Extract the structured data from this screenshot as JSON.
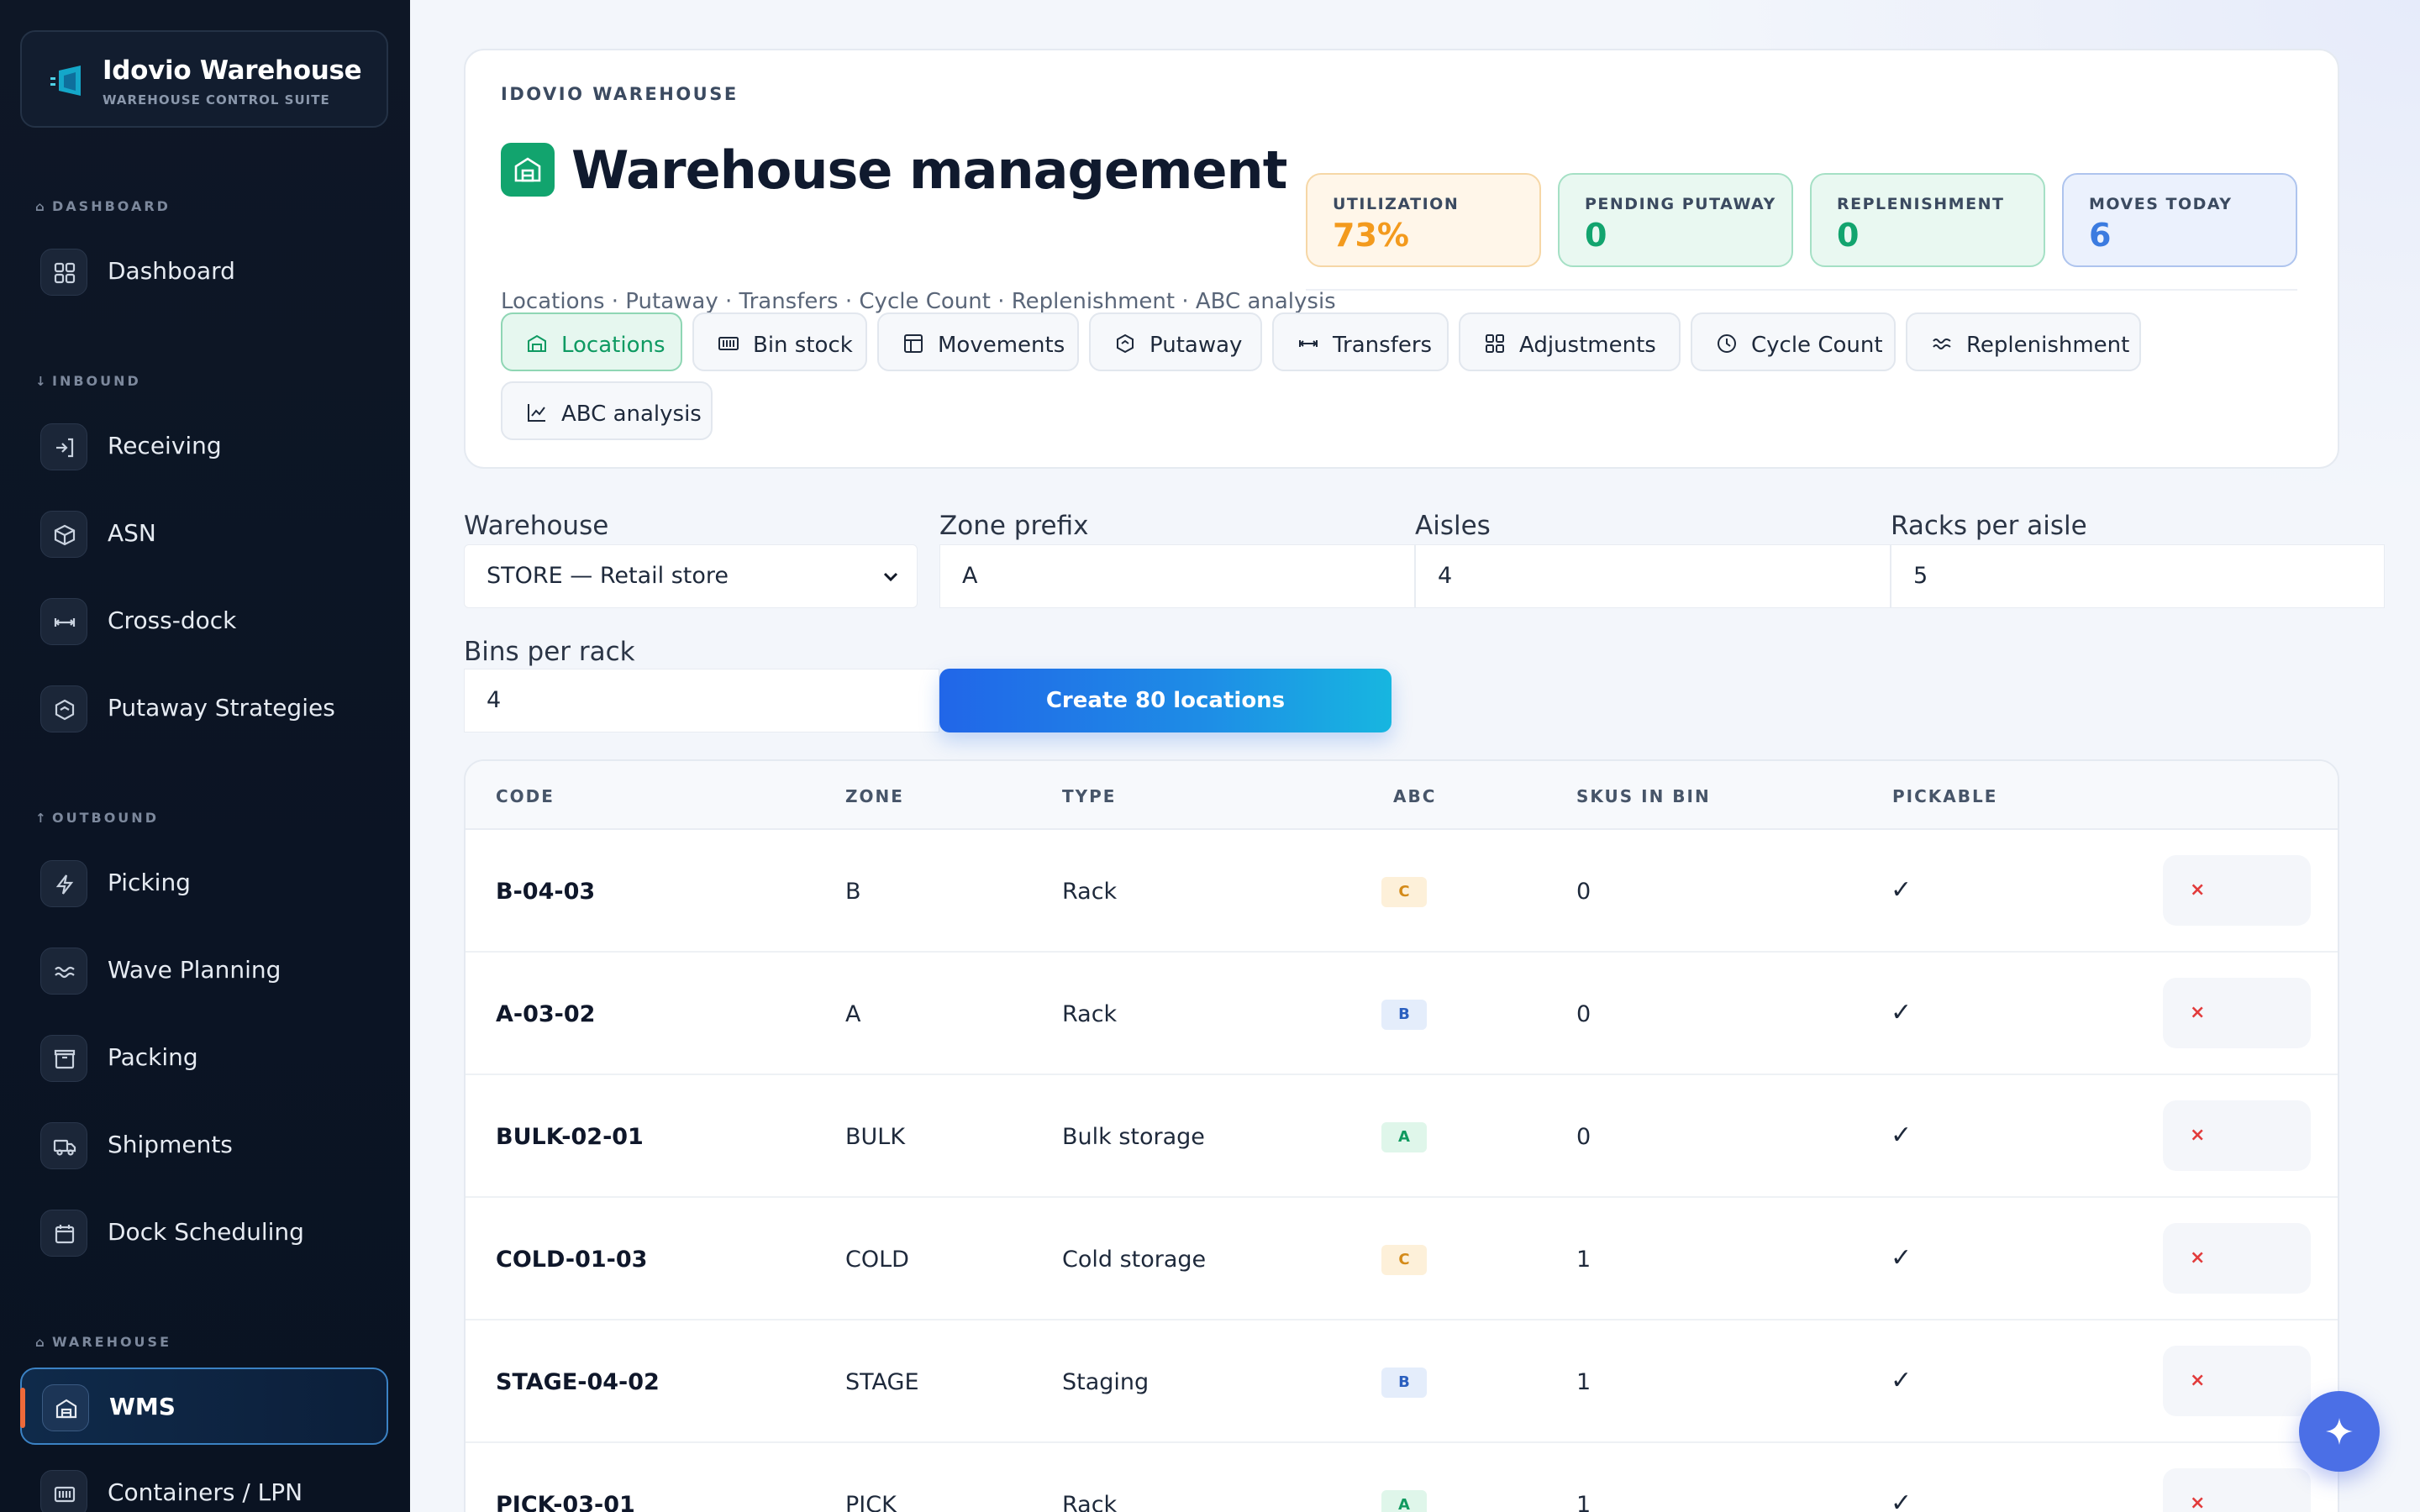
{
  "brand": {
    "title": "Idovio Warehouse",
    "subtitle": "WAREHOUSE CONTROL SUITE"
  },
  "sidebar": {
    "sections": [
      {
        "label": "DASHBOARD",
        "glyph": "⌂"
      },
      {
        "label": "INBOUND",
        "glyph": "↓"
      },
      {
        "label": "OUTBOUND",
        "glyph": "↑"
      },
      {
        "label": "WAREHOUSE",
        "glyph": "⌂"
      }
    ],
    "items": [
      {
        "label": "Dashboard",
        "icon": "grid-icon"
      },
      {
        "label": "Receiving",
        "icon": "login-icon"
      },
      {
        "label": "ASN",
        "icon": "box-icon"
      },
      {
        "label": "Cross-dock",
        "icon": "arrows-icon"
      },
      {
        "label": "Putaway Strategies",
        "icon": "hexagon-icon"
      },
      {
        "label": "Picking",
        "icon": "bolt-icon"
      },
      {
        "label": "Wave Planning",
        "icon": "waves-icon"
      },
      {
        "label": "Packing",
        "icon": "package-icon"
      },
      {
        "label": "Shipments",
        "icon": "truck-icon"
      },
      {
        "label": "Dock Scheduling",
        "icon": "calendar-icon"
      },
      {
        "label": "WMS",
        "icon": "warehouse-icon",
        "active": true
      },
      {
        "label": "Containers / LPN",
        "icon": "barcode-icon"
      }
    ]
  },
  "header": {
    "eyebrow": "IDOVIO WAREHOUSE",
    "title": "Warehouse management",
    "subtitle": "Locations · Putaway · Transfers · Cycle Count · Replenishment · ABC analysis"
  },
  "kpis": [
    {
      "label": "UTILIZATION",
      "value": "73%",
      "color": "#f39a1d"
    },
    {
      "label": "PENDING PUTAWAY",
      "value": "0",
      "color": "#12a46e"
    },
    {
      "label": "REPLENISHMENT",
      "value": "0",
      "color": "#12a46e"
    },
    {
      "label": "MOVES TODAY",
      "value": "6",
      "color": "#3b7be0"
    }
  ],
  "tabs": [
    {
      "label": "Locations",
      "active": true
    },
    {
      "label": "Bin stock"
    },
    {
      "label": "Movements"
    },
    {
      "label": "Putaway"
    },
    {
      "label": "Transfers"
    },
    {
      "label": "Adjustments"
    },
    {
      "label": "Cycle Count"
    },
    {
      "label": "Replenishment"
    },
    {
      "label": "ABC analysis"
    }
  ],
  "form": {
    "warehouse_label": "Warehouse",
    "warehouse_value": "STORE — Retail store",
    "zone_label": "Zone prefix",
    "zone_value": "A",
    "aisles_label": "Aisles",
    "aisles_value": "4",
    "racks_label": "Racks per aisle",
    "racks_value": "5",
    "bins_label": "Bins per rack",
    "bins_value": "4",
    "create_label": "Create 80 locations"
  },
  "table": {
    "headers": [
      "CODE",
      "ZONE",
      "TYPE",
      "ABC",
      "SKUS IN BIN",
      "PICKABLE"
    ],
    "rows": [
      {
        "code": "B-04-03",
        "zone": "B",
        "type": "Rack",
        "abc": "C",
        "skus": "0",
        "pickable": "✓"
      },
      {
        "code": "A-03-02",
        "zone": "A",
        "type": "Rack",
        "abc": "B",
        "skus": "0",
        "pickable": "✓"
      },
      {
        "code": "BULK-02-01",
        "zone": "BULK",
        "type": "Bulk storage",
        "abc": "A",
        "skus": "0",
        "pickable": "✓"
      },
      {
        "code": "COLD-01-03",
        "zone": "COLD",
        "type": "Cold storage",
        "abc": "C",
        "skus": "1",
        "pickable": "✓"
      },
      {
        "code": "STAGE-04-02",
        "zone": "STAGE",
        "type": "Staging",
        "abc": "B",
        "skus": "1",
        "pickable": "✓"
      },
      {
        "code": "PICK-03-01",
        "zone": "PICK",
        "type": "Rack",
        "abc": "A",
        "skus": "1",
        "pickable": "✓"
      }
    ],
    "delete_glyph": "×"
  }
}
